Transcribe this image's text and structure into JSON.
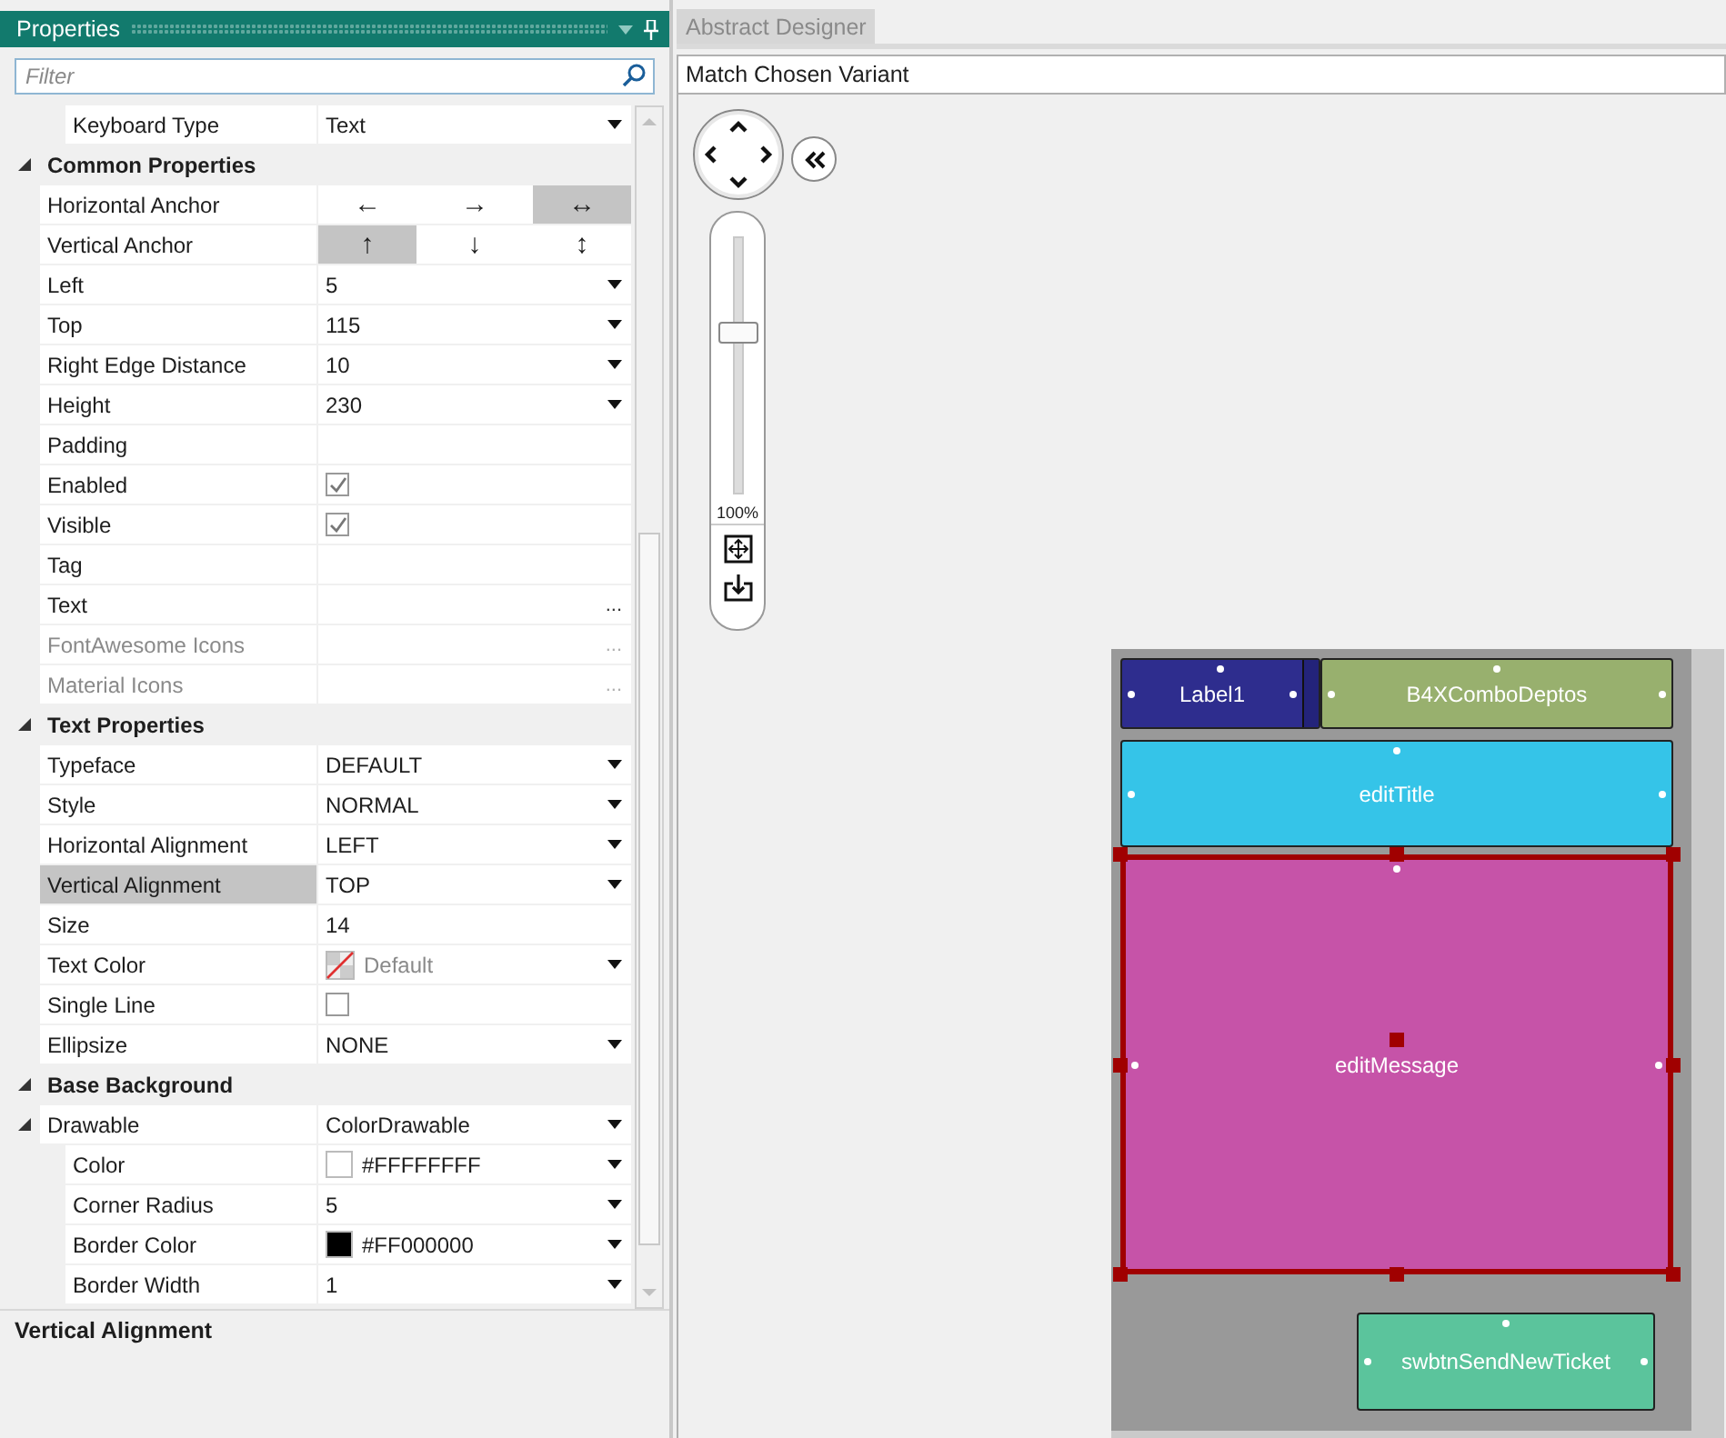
{
  "properties_panel": {
    "title": "Properties",
    "filter": {
      "placeholder": "Filter"
    },
    "continued_rows": [
      {
        "kind": "dropdown",
        "name": "Keyboard Type",
        "value": "Text",
        "selected": false,
        "disabled": false
      }
    ],
    "categories": [
      {
        "label": "Common Properties",
        "expanded": true,
        "children": [
          {
            "kind": "anchor",
            "name": "Horizontal Anchor",
            "selected": false,
            "disabled": false,
            "options": [
              {
                "symbol": "←",
                "selected": false
              },
              {
                "symbol": "→",
                "selected": false
              },
              {
                "symbol": "↔",
                "selected": true
              }
            ]
          },
          {
            "kind": "anchor",
            "name": "Vertical Anchor",
            "selected": false,
            "disabled": false,
            "options": [
              {
                "symbol": "↑",
                "selected": true
              },
              {
                "symbol": "↓",
                "selected": false
              },
              {
                "symbol": "↕",
                "selected": false
              }
            ]
          },
          {
            "kind": "dropdown",
            "name": "Left",
            "value": "5",
            "selected": false,
            "disabled": false
          },
          {
            "kind": "dropdown",
            "name": "Top",
            "value": "115",
            "selected": false,
            "disabled": false
          },
          {
            "kind": "dropdown",
            "name": "Right Edge Distance",
            "value": "10",
            "selected": false,
            "disabled": false
          },
          {
            "kind": "dropdown",
            "name": "Height",
            "value": "230",
            "selected": false,
            "disabled": false
          },
          {
            "kind": "text",
            "name": "Padding",
            "selected": false,
            "disabled": false
          },
          {
            "kind": "checkbox",
            "name": "Enabled",
            "checked": true,
            "selected": false,
            "disabled": false
          },
          {
            "kind": "checkbox",
            "name": "Visible",
            "checked": true,
            "selected": false,
            "disabled": false
          },
          {
            "kind": "text",
            "name": "Tag",
            "selected": false,
            "disabled": false
          },
          {
            "kind": "ellipsis",
            "name": "Text",
            "button": "...",
            "selected": false,
            "disabled": false
          },
          {
            "kind": "ellipsis",
            "name": "FontAwesome Icons",
            "button": "...",
            "selected": false,
            "disabled": true
          },
          {
            "kind": "ellipsis",
            "name": "Material Icons",
            "button": "...",
            "selected": false,
            "disabled": true
          }
        ]
      },
      {
        "label": "Text Properties",
        "expanded": true,
        "children": [
          {
            "kind": "dropdown",
            "name": "Typeface",
            "value": "DEFAULT",
            "selected": false,
            "disabled": false
          },
          {
            "kind": "dropdown",
            "name": "Style",
            "value": "NORMAL",
            "selected": false,
            "disabled": false
          },
          {
            "kind": "dropdown",
            "name": "Horizontal Alignment",
            "value": "LEFT",
            "selected": false,
            "disabled": false
          },
          {
            "kind": "dropdown",
            "name": "Vertical Alignment",
            "value": "TOP",
            "selected": true,
            "disabled": false
          },
          {
            "kind": "text",
            "name": "Size",
            "value": "14",
            "selected": false,
            "disabled": false
          },
          {
            "kind": "color",
            "name": "Text Color",
            "value": "Default",
            "selected": false,
            "disabled": false
          },
          {
            "kind": "checkbox",
            "name": "Single Line",
            "checked": false,
            "selected": false,
            "disabled": false
          },
          {
            "kind": "dropdown",
            "name": "Ellipsize",
            "value": "NONE",
            "selected": false,
            "disabled": false
          }
        ]
      },
      {
        "label": "Base Background",
        "expanded": true,
        "children": [
          {
            "kind": "dropdown",
            "name": "Drawable",
            "value": "ColorDrawable",
            "expanded": true,
            "selected": false,
            "disabled": false,
            "children": [
              {
                "kind": "color",
                "name": "Color",
                "value": "#FFFFFFFF",
                "color": "#ffffff",
                "selected": false,
                "disabled": false
              },
              {
                "kind": "dropdown",
                "name": "Corner Radius",
                "value": "5",
                "selected": false,
                "disabled": false
              },
              {
                "kind": "color",
                "name": "Border Color",
                "value": "#FF000000",
                "color": "#000000",
                "selected": false,
                "disabled": false
              },
              {
                "kind": "dropdown",
                "name": "Border Width",
                "value": "1",
                "selected": false,
                "disabled": false
              }
            ]
          }
        ]
      }
    ],
    "description": {
      "title": "Vertical Alignment"
    }
  },
  "designer": {
    "tabs": [
      {
        "label": "Abstract Designer",
        "selected": false
      }
    ],
    "variant": "Match Chosen Variant",
    "zoom": {
      "level": 0.68,
      "reading": "100%"
    },
    "views": [
      {
        "name": "Label1",
        "color": "#2e2d8e",
        "selected": false
      },
      {
        "name": "B4XComboDeptos",
        "color": "#98b06e",
        "selected": false
      },
      {
        "name": "editTitle",
        "color": "#35c4e8",
        "selected": false
      },
      {
        "name": "editMessage",
        "color": "#c653a8",
        "selected": true
      },
      {
        "name": "swbtnSendNewTicket",
        "color": "#5bc49c",
        "selected": false
      }
    ]
  }
}
